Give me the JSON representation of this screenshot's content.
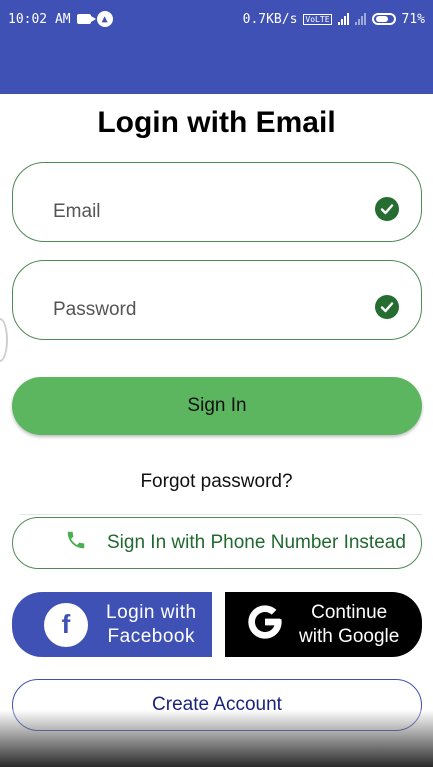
{
  "status_bar": {
    "time": "10:02 AM",
    "speed": "0.7KB/s",
    "battery_percent": "71%",
    "icons": [
      "video-camera-icon",
      "app-notification-icon",
      "volte-icon",
      "signal-icon",
      "signal-weak-icon",
      "battery-icon"
    ]
  },
  "colors": {
    "primary": "#3f51b5",
    "green_button": "#5cb55f",
    "green_text": "#22692f",
    "check": "#256d31"
  },
  "title": "Login with Email",
  "fields": {
    "email": {
      "placeholder": "Email",
      "valid": true
    },
    "password": {
      "placeholder": "Password",
      "valid": true
    }
  },
  "buttons": {
    "sign_in": "Sign In",
    "forgot_password": "Forgot password?",
    "phone": "Sign In with Phone Number Instead",
    "facebook_line1": "Login  with",
    "facebook_line2": "Facebook",
    "google_line1": "Continue",
    "google_line2": "with Google",
    "create_account": "Create Account"
  }
}
